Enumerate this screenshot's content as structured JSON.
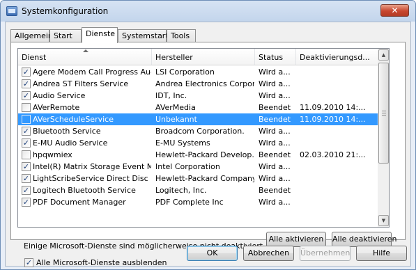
{
  "window": {
    "title": "Systemkonfiguration",
    "close_glyph": "✕"
  },
  "tabs": [
    {
      "label": "Allgemein",
      "active": false
    },
    {
      "label": "Start",
      "active": false
    },
    {
      "label": "Dienste",
      "active": true
    },
    {
      "label": "Systemstart",
      "active": false
    },
    {
      "label": "Tools",
      "active": false
    }
  ],
  "services": {
    "columns": [
      "Dienst",
      "Hersteller",
      "Status",
      "Deaktivierungsd..."
    ],
    "rows": [
      {
        "checked": true,
        "name": "Agere Modem Call Progress Audio",
        "vendor": "LSI Corporation",
        "status": "Wird a...",
        "date": ""
      },
      {
        "checked": true,
        "name": "Andrea ST Filters Service",
        "vendor": "Andrea Electronics Corpor...",
        "status": "Wird a...",
        "date": ""
      },
      {
        "checked": true,
        "name": "Audio Service",
        "vendor": "IDT, Inc.",
        "status": "Wird a...",
        "date": ""
      },
      {
        "checked": false,
        "name": "AVerRemote",
        "vendor": "AVerMedia",
        "status": "Beendet",
        "date": "11.09.2010 14:..."
      },
      {
        "checked": false,
        "name": "AVerScheduleService",
        "vendor": "Unbekannt",
        "status": "Beendet",
        "date": "11.09.2010 14:...",
        "selected": true
      },
      {
        "checked": true,
        "name": "Bluetooth Service",
        "vendor": "Broadcom Corporation.",
        "status": "Wird a...",
        "date": ""
      },
      {
        "checked": true,
        "name": "E-MU Audio Service",
        "vendor": "E-MU Systems",
        "status": "Wird a...",
        "date": ""
      },
      {
        "checked": false,
        "name": "hpqwmiex",
        "vendor": "Hewlett-Packard Develop...",
        "status": "Beendet",
        "date": "02.03.2010 21:..."
      },
      {
        "checked": true,
        "name": "Intel(R) Matrix Storage Event M...",
        "vendor": "Intel Corporation",
        "status": "Wird a...",
        "date": ""
      },
      {
        "checked": true,
        "name": "LightScribeService Direct Disc La...",
        "vendor": "Hewlett-Packard Company",
        "status": "Wird a...",
        "date": ""
      },
      {
        "checked": true,
        "name": "Logitech Bluetooth Service",
        "vendor": "Logitech, Inc.",
        "status": "Beendet",
        "date": ""
      },
      {
        "checked": true,
        "name": "PDF Document Manager",
        "vendor": "PDF Complete Inc",
        "status": "Wird a...",
        "date": ""
      }
    ]
  },
  "scrollbar": {
    "up_glyph": "▲",
    "down_glyph": "▼"
  },
  "info_text": "Einige Microsoft-Dienste sind möglicherweise nicht deaktiviert.",
  "enable_all": "Alle aktivieren",
  "disable_all": "Alle deaktivieren",
  "hide_ms": {
    "label": "Alle Microsoft-Dienste ausblenden",
    "checked": true
  },
  "buttons": {
    "ok": "OK",
    "cancel": "Abbrechen",
    "apply": "Übernehmen",
    "help": "Hilfe"
  },
  "colors": {
    "selection": "#3399ff",
    "title_bg": "#c3d5ec",
    "close": "#c8472f"
  }
}
